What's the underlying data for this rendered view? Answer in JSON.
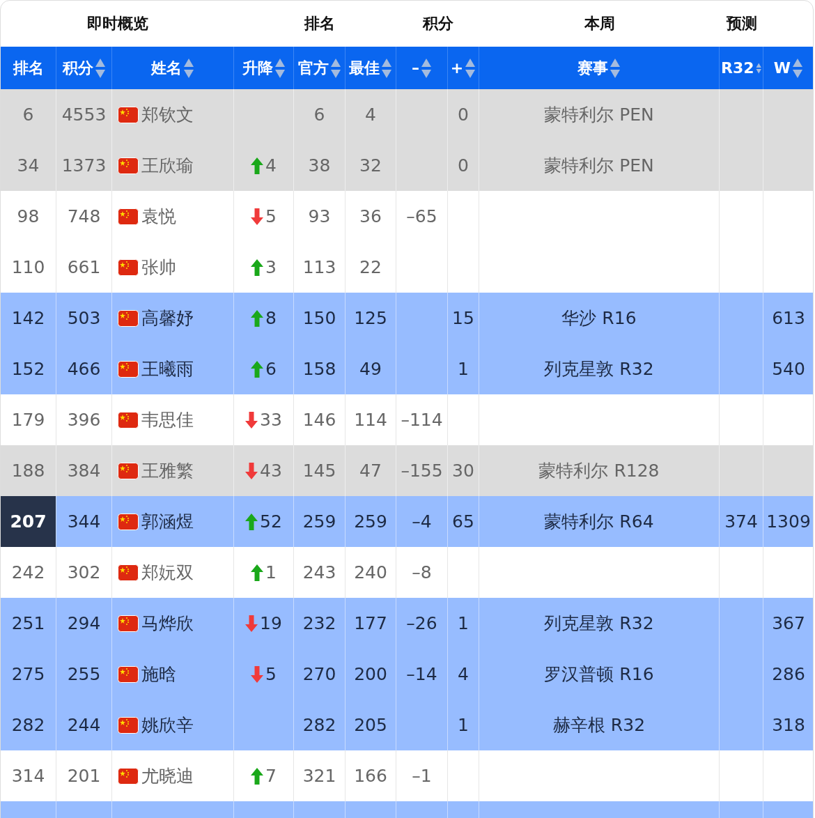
{
  "group_headers": [
    "即时概览",
    "排名",
    "积分",
    "本周",
    "预测"
  ],
  "columns": [
    {
      "label": "排名",
      "sortable": false
    },
    {
      "label": "积分",
      "sortable": true
    },
    {
      "label": "姓名",
      "sortable": true
    },
    {
      "label": "升降",
      "sortable": true
    },
    {
      "label": "官方",
      "sortable": true
    },
    {
      "label": "最佳",
      "sortable": true
    },
    {
      "label": "–",
      "sortable": true
    },
    {
      "label": "+",
      "sortable": true
    },
    {
      "label": "赛事",
      "sortable": true
    },
    {
      "label": "R32",
      "sortable": true
    },
    {
      "label": "W",
      "sortable": true
    }
  ],
  "rows": [
    {
      "kind": "shaded",
      "current": false,
      "rank": "6",
      "points": "4553",
      "name": "郑钦文",
      "official": "6",
      "best": "4",
      "plus": "0",
      "event": "蒙特利尔 PEN"
    },
    {
      "kind": "shaded",
      "current": false,
      "rank": "34",
      "points": "1373",
      "name": "王欣瑜",
      "change": {
        "kind": "rise",
        "value": "4"
      },
      "official": "38",
      "best": "32",
      "plus": "0",
      "event": "蒙特利尔 PEN"
    },
    {
      "kind": "plain",
      "current": false,
      "rank": "98",
      "points": "748",
      "name": "袁悦",
      "change": {
        "kind": "fall",
        "value": "5"
      },
      "official": "93",
      "best": "36",
      "minus": "–65"
    },
    {
      "kind": "plain",
      "current": false,
      "rank": "110",
      "points": "661",
      "name": "张帅",
      "change": {
        "kind": "rise",
        "value": "3"
      },
      "official": "113",
      "best": "22"
    },
    {
      "kind": "highlighted",
      "current": false,
      "rank": "142",
      "points": "503",
      "name": "高馨妤",
      "change": {
        "kind": "rise",
        "value": "8"
      },
      "official": "150",
      "best": "125",
      "plus": "15",
      "event": "华沙 R16",
      "w": "613"
    },
    {
      "kind": "highlighted",
      "current": false,
      "rank": "152",
      "points": "466",
      "name": "王曦雨",
      "change": {
        "kind": "rise",
        "value": "6"
      },
      "official": "158",
      "best": "49",
      "plus": "1",
      "event": "列克星敦 R32",
      "w": "540"
    },
    {
      "kind": "plain",
      "current": false,
      "rank": "179",
      "points": "396",
      "name": "韦思佳",
      "change": {
        "kind": "fall",
        "value": "33"
      },
      "official": "146",
      "best": "114",
      "minus": "–114"
    },
    {
      "kind": "shaded",
      "current": false,
      "rank": "188",
      "points": "384",
      "name": "王雅繁",
      "change": {
        "kind": "fall",
        "value": "43"
      },
      "official": "145",
      "best": "47",
      "minus": "–155",
      "plus": "30",
      "event": "蒙特利尔 R128"
    },
    {
      "kind": "highlighted",
      "current": true,
      "rank": "207",
      "points": "344",
      "name": "郭涵煜",
      "change": {
        "kind": "rise",
        "value": "52"
      },
      "official": "259",
      "best": "259",
      "minus": "–4",
      "plus": "65",
      "event": "蒙特利尔 R64",
      "r32": "374",
      "w": "1309"
    },
    {
      "kind": "plain",
      "current": false,
      "rank": "242",
      "points": "302",
      "name": "郑妧双",
      "change": {
        "kind": "rise",
        "value": "1"
      },
      "official": "243",
      "best": "240",
      "minus": "–8"
    },
    {
      "kind": "highlighted",
      "current": false,
      "rank": "251",
      "points": "294",
      "name": "马烨欣",
      "change": {
        "kind": "fall",
        "value": "19"
      },
      "official": "232",
      "best": "177",
      "minus": "–26",
      "plus": "1",
      "event": "列克星敦 R32",
      "w": "367"
    },
    {
      "kind": "highlighted",
      "current": false,
      "rank": "275",
      "points": "255",
      "name": "施晗",
      "change": {
        "kind": "fall",
        "value": "5"
      },
      "official": "270",
      "best": "200",
      "minus": "–14",
      "plus": "4",
      "event": "罗汉普顿 R16",
      "w": "286"
    },
    {
      "kind": "highlighted",
      "current": false,
      "rank": "282",
      "points": "244",
      "name": "姚欣辛",
      "official": "282",
      "best": "205",
      "plus": "1",
      "event": "赫辛根 R32",
      "w": "318"
    },
    {
      "kind": "plain",
      "current": false,
      "rank": "314",
      "points": "201",
      "name": "尤晓迪",
      "change": {
        "kind": "rise",
        "value": "7"
      },
      "official": "321",
      "best": "166",
      "minus": "–1"
    },
    {
      "kind": "highlighted",
      "current": false
    }
  ]
}
